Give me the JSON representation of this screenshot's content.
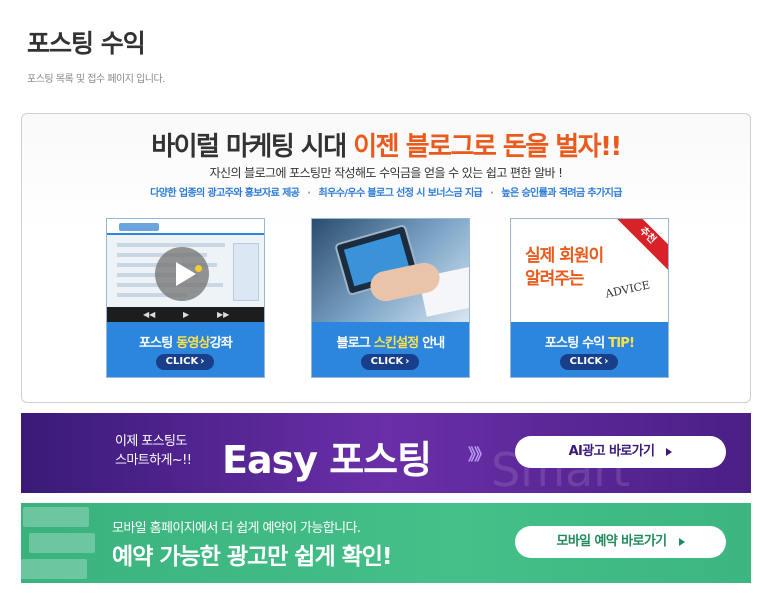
{
  "page": {
    "title": "포스팅 수익",
    "subtitle": "포스팅 목록 및 접수 페이지 입니다."
  },
  "promo": {
    "headline_dark": "바이럴 마케팅 시대",
    "headline_highlight": "이젠 블로그로 돈을 벌자!!",
    "tagline": "자신의 블로그에 포스팅만 작성해도 수익금을 얻을 수 있는 쉽고 편한 알바 !",
    "features": [
      "다양한 업종의 광고주와 홍보자료 제공",
      "최우수/우수 블로그 선정 시 보너스금 지급",
      "높은 승인률과 격려금 추가지급"
    ],
    "feature_separator": "·",
    "cards": [
      {
        "label_before": "포스팅 ",
        "label_highlight": "동영상",
        "label_after": "강좌",
        "click": "CLICK",
        "icon": "video-play-icon"
      },
      {
        "label_before": "블로그 ",
        "label_highlight": "스킨설정",
        "label_after": " 안내",
        "click": "CLICK",
        "icon": "tablet-photo"
      },
      {
        "label_before": "포스팅 수익 ",
        "label_highlight": "TIP!",
        "label_after": "",
        "click": "CLICK",
        "thumb_line1": "실제 회원이",
        "thumb_line2": "알려주는",
        "thumb_advice": "ADVICE",
        "ribbon": "추천"
      }
    ],
    "accent_color": "#ea5a1d",
    "card_label_bg": "#2d86de"
  },
  "banner_ai": {
    "small_line1": "이제 포스팅도",
    "small_line2": "스마트하게~!!",
    "big": "Easy 포스팅",
    "arrows": "》》",
    "deco": "Smart",
    "button": "AI광고 바로가기",
    "bg_color": "#4a1f86"
  },
  "banner_mobile": {
    "small": "모바일 홈페이지에서 더 쉽게 예약이 가능합니다.",
    "big": "예약 가능한 광고만 쉽게 확인!",
    "button": "모바일 예약 바로가기",
    "bg_color": "#45c089"
  }
}
